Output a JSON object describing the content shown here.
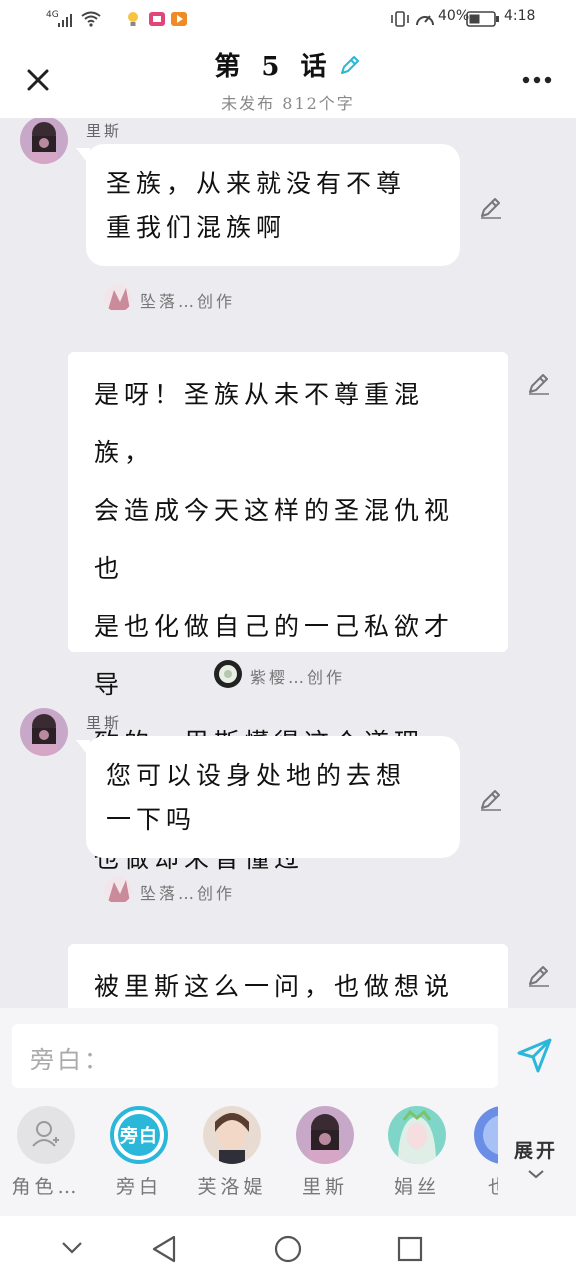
{
  "status_bar": {
    "network": "4G",
    "battery_pct": "40%",
    "time": "4:18"
  },
  "header": {
    "title": "第 5 话",
    "subtitle": "未发布 812个字"
  },
  "messages": [
    {
      "type": "character",
      "speaker": "里斯",
      "text_lines": [
        "圣族，从来就没有不尊",
        "重我们混族啊"
      ],
      "credit_author": "坠落…创作"
    },
    {
      "type": "narration",
      "text_lines": [
        "是呀！圣族从未不尊重混族，",
        "会造成今天这样的圣混仇视也",
        "是也化做自己的一己私欲才导",
        "致的，里斯懂得这个道理，可",
        "也做却未曾懂过"
      ],
      "credit_author": "紫樱…创作"
    },
    {
      "type": "character",
      "speaker": "里斯",
      "text_lines": [
        "您可以设身处地的去想",
        "一下吗"
      ],
      "credit_author": "坠落…创作"
    },
    {
      "type": "narration",
      "text_lines": [
        "被里斯这么一问，也做想说什"
      ]
    }
  ],
  "input": {
    "placeholder": "旁白："
  },
  "characters": [
    {
      "name": "角色…",
      "kind": "add"
    },
    {
      "name": "旁白",
      "kind": "narrator",
      "badge": "旁白"
    },
    {
      "name": "芙洛媞",
      "kind": "photo"
    },
    {
      "name": "里斯",
      "kind": "photo"
    },
    {
      "name": "娟丝",
      "kind": "photo"
    },
    {
      "name": "也",
      "kind": "photo"
    }
  ],
  "expand_label": "展开",
  "colors": {
    "accent": "#2bb7d9",
    "background": "#ececf0",
    "bubble": "#ffffff"
  }
}
